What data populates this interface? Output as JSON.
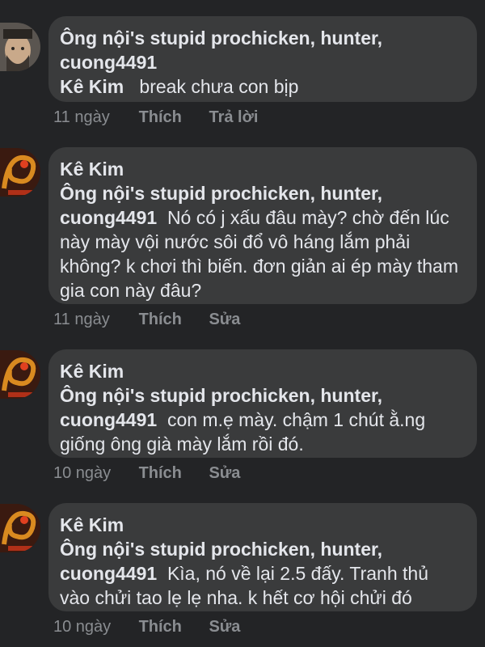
{
  "comments": [
    {
      "author": "",
      "mention": "Ông nội's stupid prochicken, hunter, cuong4491",
      "reply_to": "Kê Kim",
      "text": "break chưa con bịp",
      "time": "11 ngày",
      "actions": [
        "Thích",
        "Trả lời"
      ]
    },
    {
      "author": "Kê Kim",
      "mention": "Ông nội's stupid prochicken, hunter, cuong4491",
      "text": "Nó có j xấu đâu mày? chờ đến lúc này mày vội nước sôi đổ vô háng lắm phải không? k chơi thì biến. đơn giản ai ép mày tham gia con này đâu?",
      "time": "11 ngày",
      "actions": [
        "Thích",
        "Sửa"
      ]
    },
    {
      "author": "Kê Kim",
      "mention": "Ông nội's stupid prochicken, hunter, cuong4491",
      "text": "con m.ẹ mày. chậm 1 chút ằ.ng giống ông già mày lắm rồi đó.",
      "time": "10 ngày",
      "actions": [
        "Thích",
        "Sửa"
      ]
    },
    {
      "author": "Kê Kim",
      "mention": "Ông nội's stupid prochicken, hunter, cuong4491",
      "text": "Kìa, nó về lại 2.5 đấy. Tranh thủ vào chửi tao lẹ lẹ nha. k hết cơ hội chửi đó",
      "time": "10 ngày",
      "actions": [
        "Thích",
        "Sửa"
      ]
    }
  ],
  "icons": {
    "avatar_1": "portrait-avatar-icon",
    "avatar_kekim": "dragon-avatar-icon"
  },
  "colors": {
    "background": "#232426",
    "bubble": "#3a3b3c",
    "text": "#e4e6eb",
    "meta": "#8a8d91"
  }
}
